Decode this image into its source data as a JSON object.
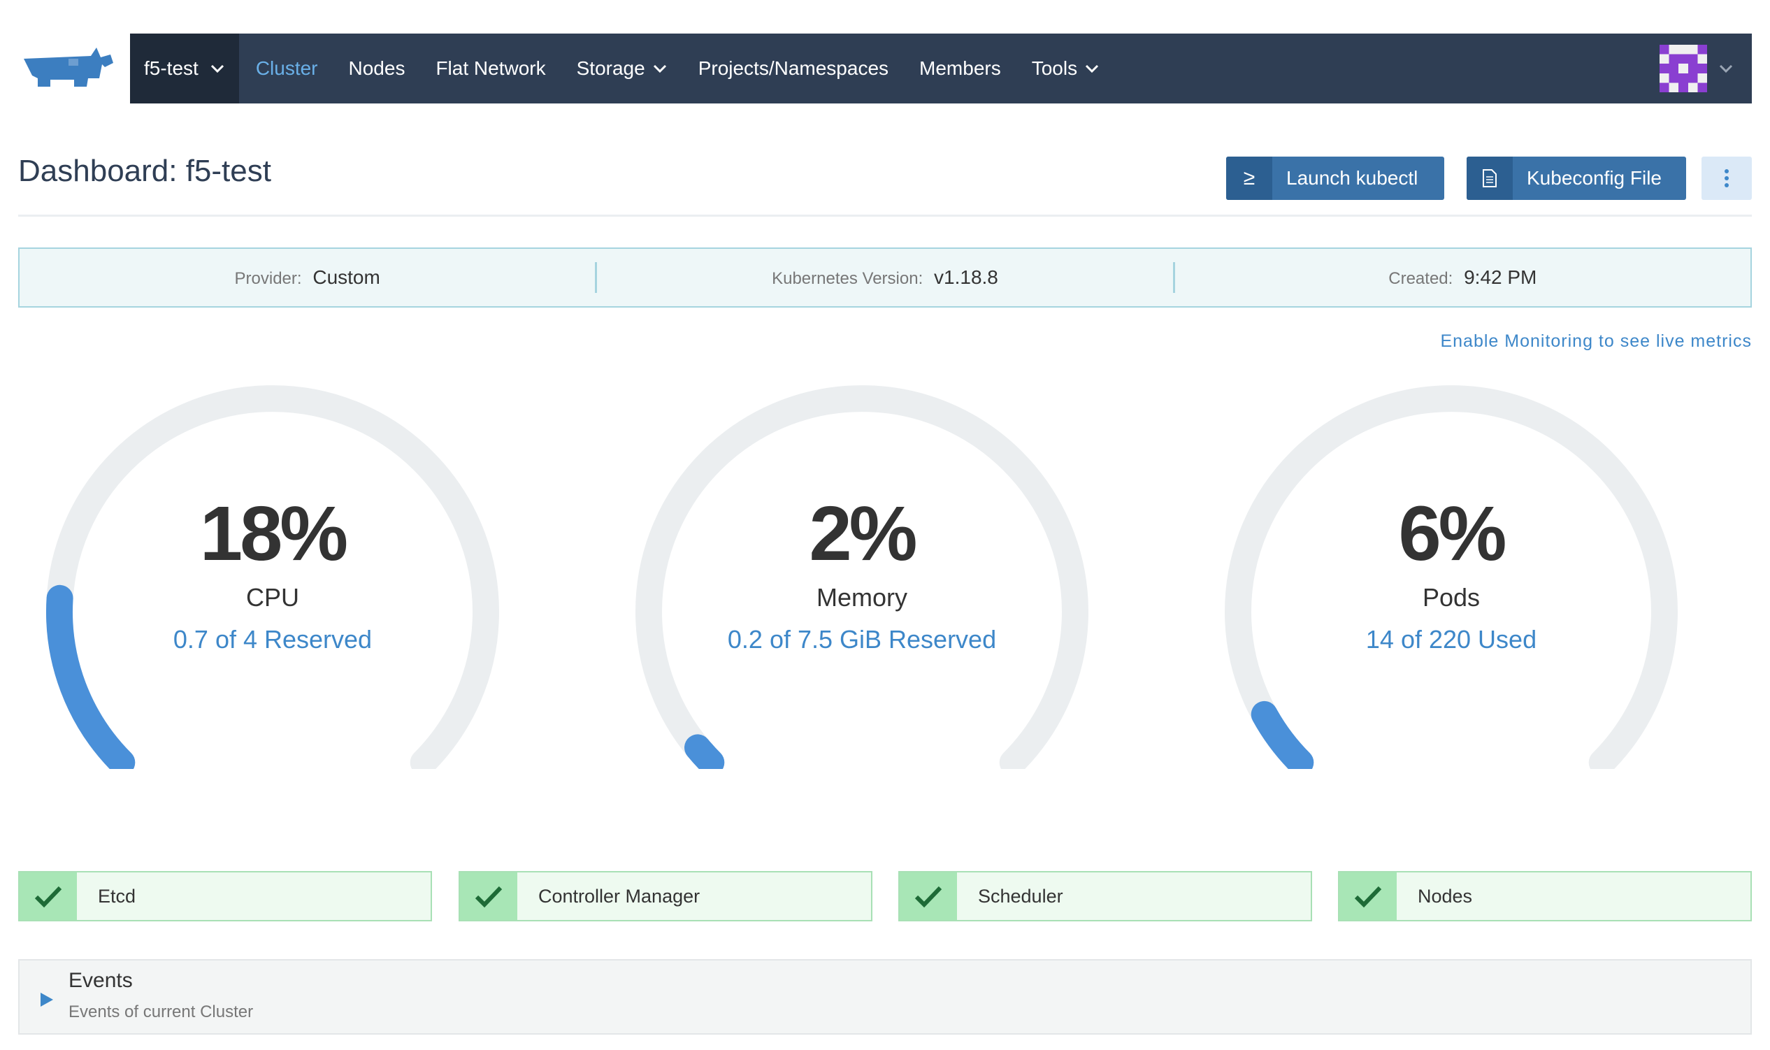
{
  "header": {
    "cluster_name": "f5-test",
    "nav": [
      {
        "label": "Cluster",
        "active": true,
        "dropdown": false
      },
      {
        "label": "Nodes",
        "active": false,
        "dropdown": false
      },
      {
        "label": "Flat Network",
        "active": false,
        "dropdown": false
      },
      {
        "label": "Storage",
        "active": false,
        "dropdown": true
      },
      {
        "label": "Projects/Namespaces",
        "active": false,
        "dropdown": false
      },
      {
        "label": "Members",
        "active": false,
        "dropdown": false
      },
      {
        "label": "Tools",
        "active": false,
        "dropdown": true
      }
    ]
  },
  "page": {
    "title": "Dashboard: f5-test",
    "kubectl_icon": "≥",
    "kubectl_label": "Launch kubectl",
    "kubeconfig_label": "Kubeconfig File"
  },
  "info": {
    "provider_label": "Provider:",
    "provider_value": "Custom",
    "k8s_label": "Kubernetes Version:",
    "k8s_value": "v1.18.8",
    "created_label": "Created:",
    "created_value": "9:42 PM"
  },
  "monitoring_link": "Enable Monitoring to see live metrics",
  "gauges": [
    {
      "percent": "18%",
      "fraction": 0.18,
      "name": "CPU",
      "detail": "0.7 of 4 Reserved"
    },
    {
      "percent": "2%",
      "fraction": 0.02,
      "name": "Memory",
      "detail": "0.2 of 7.5 GiB Reserved"
    },
    {
      "percent": "6%",
      "fraction": 0.06,
      "name": "Pods",
      "detail": "14 of 220 Used"
    }
  ],
  "components": [
    {
      "label": "Etcd"
    },
    {
      "label": "Controller Manager"
    },
    {
      "label": "Scheduler"
    },
    {
      "label": "Nodes"
    }
  ],
  "events": {
    "title": "Events",
    "subtitle": "Events of current Cluster"
  },
  "colors": {
    "navbar": "#2f3e54",
    "accent": "#3d87c9",
    "gauge_track": "#ebeef0",
    "gauge_fill": "#4a90d9",
    "status_ok": "#a8e6b6"
  }
}
